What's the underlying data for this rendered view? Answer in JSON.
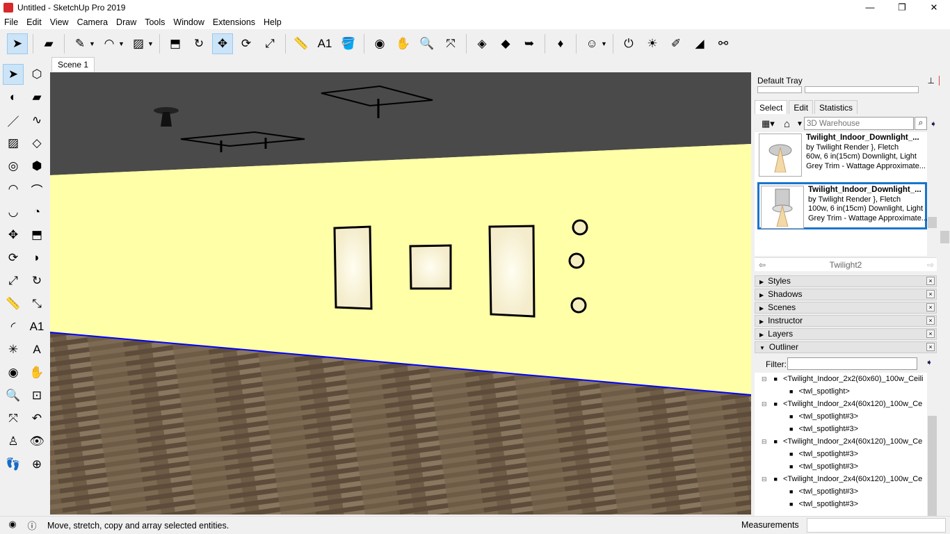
{
  "window": {
    "title": "Untitled - SketchUp Pro 2019",
    "minimize": "—",
    "maximize": "❐",
    "close": "✕"
  },
  "menu": [
    "File",
    "Edit",
    "View",
    "Camera",
    "Draw",
    "Tools",
    "Window",
    "Extensions",
    "Help"
  ],
  "toolbar": [
    {
      "icon": "select-arrow-icon",
      "glyph": "➤",
      "active": true
    },
    {
      "sep": true
    },
    {
      "icon": "eraser-icon",
      "glyph": "▰"
    },
    {
      "sep": true
    },
    {
      "icon": "pencil-line-icon",
      "glyph": "✎",
      "caret": true
    },
    {
      "icon": "arc-icon",
      "glyph": "◠",
      "caret": true
    },
    {
      "icon": "rectangle-icon",
      "glyph": "▨",
      "caret": true
    },
    {
      "sep": true
    },
    {
      "icon": "push-pull-icon",
      "glyph": "⬒"
    },
    {
      "icon": "offset-icon",
      "glyph": "↻"
    },
    {
      "icon": "move-icon",
      "glyph": "✥",
      "active": true
    },
    {
      "icon": "rotate-icon",
      "glyph": "⟳"
    },
    {
      "icon": "scale-icon",
      "glyph": "⤢"
    },
    {
      "sep": true
    },
    {
      "icon": "tape-measure-icon",
      "glyph": "📏"
    },
    {
      "icon": "text-icon",
      "glyph": "A1"
    },
    {
      "icon": "paint-bucket-icon",
      "glyph": "🪣"
    },
    {
      "sep": true
    },
    {
      "icon": "orbit-icon",
      "glyph": "◉"
    },
    {
      "icon": "pan-icon",
      "glyph": "✋"
    },
    {
      "icon": "zoom-icon",
      "glyph": "🔍"
    },
    {
      "icon": "zoom-extents-icon",
      "glyph": "⤧"
    },
    {
      "sep": true
    },
    {
      "icon": "3d-warehouse-icon",
      "glyph": "◈"
    },
    {
      "icon": "extension-warehouse-icon",
      "glyph": "◆"
    },
    {
      "icon": "send-to-layout-icon",
      "glyph": "➥"
    },
    {
      "sep": true
    },
    {
      "icon": "extension-ruby-icon",
      "glyph": "♦"
    },
    {
      "sep": true
    },
    {
      "icon": "user-account-icon",
      "glyph": "☺",
      "caret": true
    },
    {
      "sep": true
    },
    {
      "icon": "twilight-render-icon",
      "glyph": "⏻"
    },
    {
      "icon": "twilight-sun-icon",
      "glyph": "☀"
    },
    {
      "icon": "twilight-material-icon",
      "glyph": "✐"
    },
    {
      "icon": "twilight-paint-icon",
      "glyph": "◢"
    },
    {
      "icon": "binoculars-icon",
      "glyph": "⚯"
    }
  ],
  "left_toolbar": [
    {
      "icon": "select-icon",
      "glyph": "➤",
      "active": true
    },
    {
      "icon": "make-component-icon",
      "glyph": "⬡"
    },
    {
      "icon": "paint-bucket-icon",
      "glyph": "◐"
    },
    {
      "icon": "eraser-icon",
      "glyph": "▰"
    },
    {
      "icon": "line-icon",
      "glyph": "／"
    },
    {
      "icon": "freehand-icon",
      "glyph": "∿"
    },
    {
      "icon": "rectangle-icon",
      "glyph": "▨"
    },
    {
      "icon": "rotated-rectangle-icon",
      "glyph": "◇"
    },
    {
      "icon": "circle-icon",
      "glyph": "◎"
    },
    {
      "icon": "polygon-icon",
      "glyph": "⬢"
    },
    {
      "icon": "arc-icon",
      "glyph": "◠"
    },
    {
      "icon": "two-point-arc-icon",
      "glyph": "⌒"
    },
    {
      "icon": "three-point-arc-icon",
      "glyph": "◡"
    },
    {
      "icon": "pie-icon",
      "glyph": "◔"
    },
    {
      "icon": "move-icon",
      "glyph": "✥"
    },
    {
      "icon": "push-pull-icon",
      "glyph": "⬒"
    },
    {
      "icon": "rotate-icon",
      "glyph": "⟳"
    },
    {
      "icon": "follow-me-icon",
      "glyph": "◗"
    },
    {
      "icon": "scale-icon",
      "glyph": "⤢"
    },
    {
      "icon": "offset-icon",
      "glyph": "↻"
    },
    {
      "icon": "tape-measure-icon",
      "glyph": "📏"
    },
    {
      "icon": "dimension-icon",
      "glyph": "⤡"
    },
    {
      "icon": "protractor-icon",
      "glyph": "◜"
    },
    {
      "icon": "text-icon",
      "glyph": "A1"
    },
    {
      "icon": "axes-icon",
      "glyph": "✳"
    },
    {
      "icon": "3d-text-icon",
      "glyph": "A"
    },
    {
      "icon": "orbit-icon",
      "glyph": "◉"
    },
    {
      "icon": "pan-icon",
      "glyph": "✋"
    },
    {
      "icon": "zoom-icon",
      "glyph": "🔍"
    },
    {
      "icon": "zoom-window-icon",
      "glyph": "⊡"
    },
    {
      "icon": "zoom-extents-icon",
      "glyph": "⤧"
    },
    {
      "icon": "previous-view-icon",
      "glyph": "↶"
    },
    {
      "icon": "position-camera-icon",
      "glyph": "♙"
    },
    {
      "icon": "look-around-icon",
      "glyph": "👁"
    },
    {
      "icon": "walk-icon",
      "glyph": "👣"
    },
    {
      "icon": "section-plane-icon",
      "glyph": "⊕"
    }
  ],
  "scene_tab": "Scene 1",
  "colors": {
    "ceiling": "#4a4a4a",
    "wall": "#ffffa8",
    "floor": "#6b5a45",
    "axis_blue": "#0000ff",
    "selection": "#1874cd"
  },
  "tray": {
    "title": "Default Tray",
    "pin": "📌",
    "close": "x",
    "tabs": [
      "Select",
      "Edit",
      "Statistics"
    ],
    "search_placeholder": "3D Warehouse",
    "results": [
      {
        "name": "Twilight_Indoor_Downlight_...",
        "by": "by Twilight Render }, Fletch",
        "desc1": "60w, 6 in(15cm) Downlight, Light",
        "desc2": "Grey Trim - Wattage Approximate..."
      },
      {
        "name": "Twilight_Indoor_Downlight_...",
        "by": "by Twilight Render }, Fletch",
        "desc1": "100w, 6 in(15cm) Downlight, Light",
        "desc2": "Grey Trim - Wattage Approximate..."
      }
    ],
    "collection": "Twilight2",
    "panels": [
      {
        "label": "Styles",
        "arrow": "▶"
      },
      {
        "label": "Shadows",
        "arrow": "▶"
      },
      {
        "label": "Scenes",
        "arrow": "▶"
      },
      {
        "label": "Instructor",
        "arrow": "▶"
      },
      {
        "label": "Layers",
        "arrow": "▶"
      },
      {
        "label": "Outliner",
        "arrow": "▼"
      }
    ],
    "filter_label": "Filter:",
    "outliner": [
      {
        "text": "<Twilight_Indoor_2x2(60x60)_100w_Ceili",
        "level": 0
      },
      {
        "text": "<twl_spotlight>",
        "level": 1
      },
      {
        "text": "<Twilight_Indoor_2x4(60x120)_100w_Ce",
        "level": 0
      },
      {
        "text": "<twl_spotlight#3>",
        "level": 1
      },
      {
        "text": "<twl_spotlight#3>",
        "level": 1
      },
      {
        "text": "<Twilight_Indoor_2x4(60x120)_100w_Ce",
        "level": 0
      },
      {
        "text": "<twl_spotlight#3>",
        "level": 1
      },
      {
        "text": "<twl_spotlight#3>",
        "level": 1
      },
      {
        "text": "<Twilight_Indoor_2x4(60x120)_100w_Ce",
        "level": 0
      },
      {
        "text": "<twl_spotlight#3>",
        "level": 1
      },
      {
        "text": "<twl_spotlight#3>",
        "level": 1
      }
    ]
  },
  "status": {
    "message": "Move, stretch, copy and array selected entities.",
    "measurements_label": "Measurements",
    "measurements_value": ""
  }
}
